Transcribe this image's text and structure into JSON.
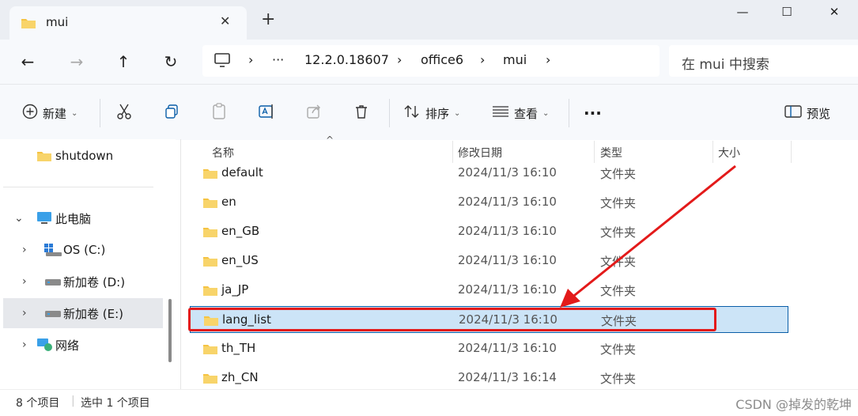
{
  "tab": {
    "title": "mui",
    "close": "✕",
    "new": "+"
  },
  "window": {
    "minimize": "—",
    "maximize": "☐",
    "close": "✕"
  },
  "nav": {
    "back": "←",
    "forward": "→",
    "up": "↑",
    "refresh": "↻"
  },
  "address": {
    "crumbs": [
      "12.2.0.18607",
      "office6",
      "mui"
    ],
    "more": "···",
    "sep": "›"
  },
  "search": {
    "placeholder": "在 mui 中搜索"
  },
  "toolbar": {
    "new_label": "新建",
    "sort_label": "排序",
    "view_label": "查看",
    "more_label": "···",
    "preview_label": "预览"
  },
  "sidebar": {
    "items": [
      {
        "label": "shutdown"
      },
      {
        "label": "此电脑"
      },
      {
        "label": "OS (C:)"
      },
      {
        "label": "新加卷 (D:)"
      },
      {
        "label": "新加卷 (E:)"
      },
      {
        "label": "网络"
      }
    ]
  },
  "columns": {
    "name": "名称",
    "date": "修改日期",
    "type": "类型",
    "size": "大小"
  },
  "files": [
    {
      "name": "default",
      "date": "2024/11/3 16:10",
      "type": "文件夹"
    },
    {
      "name": "en",
      "date": "2024/11/3 16:10",
      "type": "文件夹"
    },
    {
      "name": "en_GB",
      "date": "2024/11/3 16:10",
      "type": "文件夹"
    },
    {
      "name": "en_US",
      "date": "2024/11/3 16:10",
      "type": "文件夹"
    },
    {
      "name": "ja_JP",
      "date": "2024/11/3 16:10",
      "type": "文件夹"
    },
    {
      "name": "lang_list",
      "date": "2024/11/3 16:10",
      "type": "文件夹"
    },
    {
      "name": "th_TH",
      "date": "2024/11/3 16:10",
      "type": "文件夹"
    },
    {
      "name": "zh_CN",
      "date": "2024/11/3 16:14",
      "type": "文件夹"
    }
  ],
  "status": {
    "count": "8 个项目",
    "selected": "选中 1 个项目"
  },
  "watermark": "CSDN @掉发的乾坤",
  "colors": {
    "folder": "#f5c342",
    "accent": "#0a5ea8",
    "highlight": "#e31a1a",
    "selection": "#cce4f7"
  }
}
